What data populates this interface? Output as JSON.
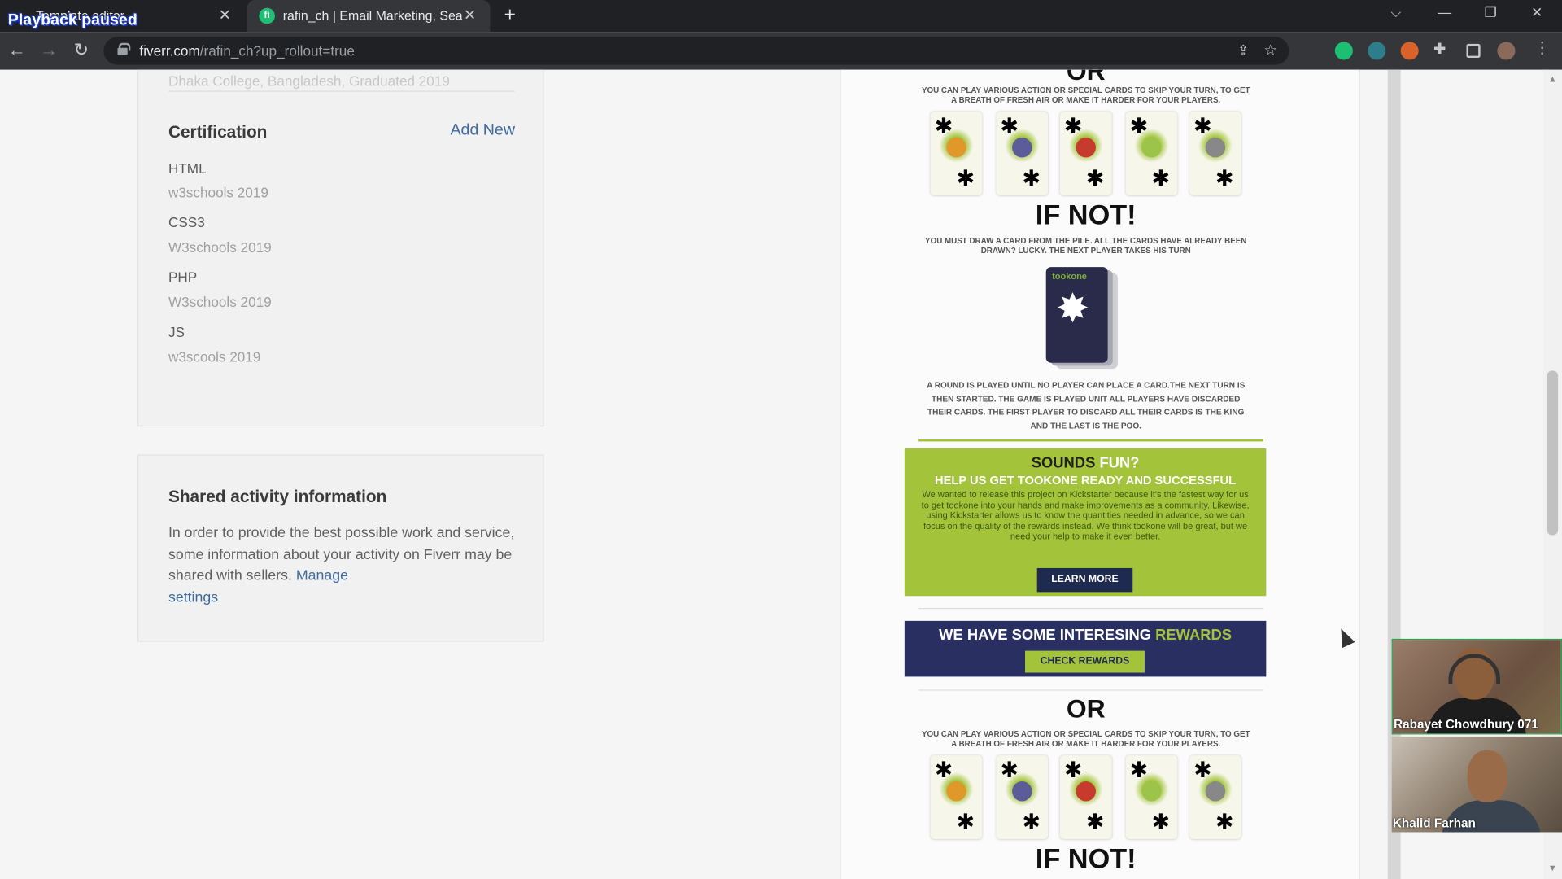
{
  "browser": {
    "tabs": [
      {
        "title": "Template editor",
        "active": false
      },
      {
        "title": "rafin_ch | Email Marketing, Searc",
        "active": true
      }
    ],
    "overlay_label": "Playback paused",
    "url_domain": "fiverr.com",
    "url_path": "/rafin_ch?up_rollout=true"
  },
  "profile": {
    "faded_education_text": "Dhaka College, Bangladesh, Graduated 2019",
    "certification": {
      "title": "Certification",
      "add_new": "Add New",
      "items": [
        {
          "name": "HTML",
          "source": "w3schools 2019"
        },
        {
          "name": "CSS3",
          "source": "W3schools 2019"
        },
        {
          "name": "PHP",
          "source": "W3schools 2019"
        },
        {
          "name": "JS",
          "source": "w3scools 2019"
        }
      ]
    },
    "shared_activity": {
      "title": "Shared activity information",
      "text": "In order to provide the best possible work and service, some information about your activity on Fiverr may be shared with sellers.",
      "link_manage": "Manage",
      "link_settings": "settings"
    }
  },
  "email_preview": {
    "or_top": "OR",
    "play_text": "YOU CAN PLAY VARIOUS ACTION OR SPECIAL CARDS TO SKIP YOUR TURN, TO GET A BREATH OF FRESH AIR OR MAKE IT HARDER FOR YOUR PLAYERS.",
    "if_not": "IF NOT!",
    "draw_text": "YOU MUST DRAW A CARD FROM THE PILE. ALL THE CARDS HAVE ALREADY BEEN DRAWN? LUCKY. THE NEXT PLAYER TAKES HIS TURN",
    "deck_label": "tookone",
    "round_text": "A ROUND IS PLAYED UNTIL NO PLAYER CAN PLACE A CARD.THE NEXT TURN IS THEN STARTED. THE GAME IS PLAYED UNIT ALL PLAYERS HAVE DISCARDED THEIR CARDS. THE FIRST PLAYER TO DISCARD ALL THEIR CARDS IS THE KING AND THE LAST IS THE POO.",
    "sounds": "SOUNDS",
    "fun": "FUN?",
    "help_title": "HELP US GET TOOKONE READY AND SUCCESSFUL",
    "help_text": "We wanted to release this project on Kickstarter because it's the fastest way for us to get tookone into your hands and make improvements as a community. Likewise, using Kickstarter allows us to know the quantities needed in advance, so we can focus on the quality of the rewards instead. We think tookone will be great, but we need your help to make it even better.",
    "learn_more": "LEARN MORE",
    "rewards_pre": "WE HAVE SOME INTERESING",
    "rewards_word": "REWARDS",
    "check_rewards": "CHECK REWARDS",
    "or_bottom": "OR",
    "if_not_bottom": "IF NOT!"
  },
  "video_call": {
    "participants": [
      {
        "name": "Rabayet Chowdhury 071"
      },
      {
        "name": "Khalid Farhan"
      }
    ]
  },
  "colors": {
    "accent_green": "#a3c33b",
    "navy": "#2a2f62",
    "fiverr_link": "#3d6aa0"
  }
}
